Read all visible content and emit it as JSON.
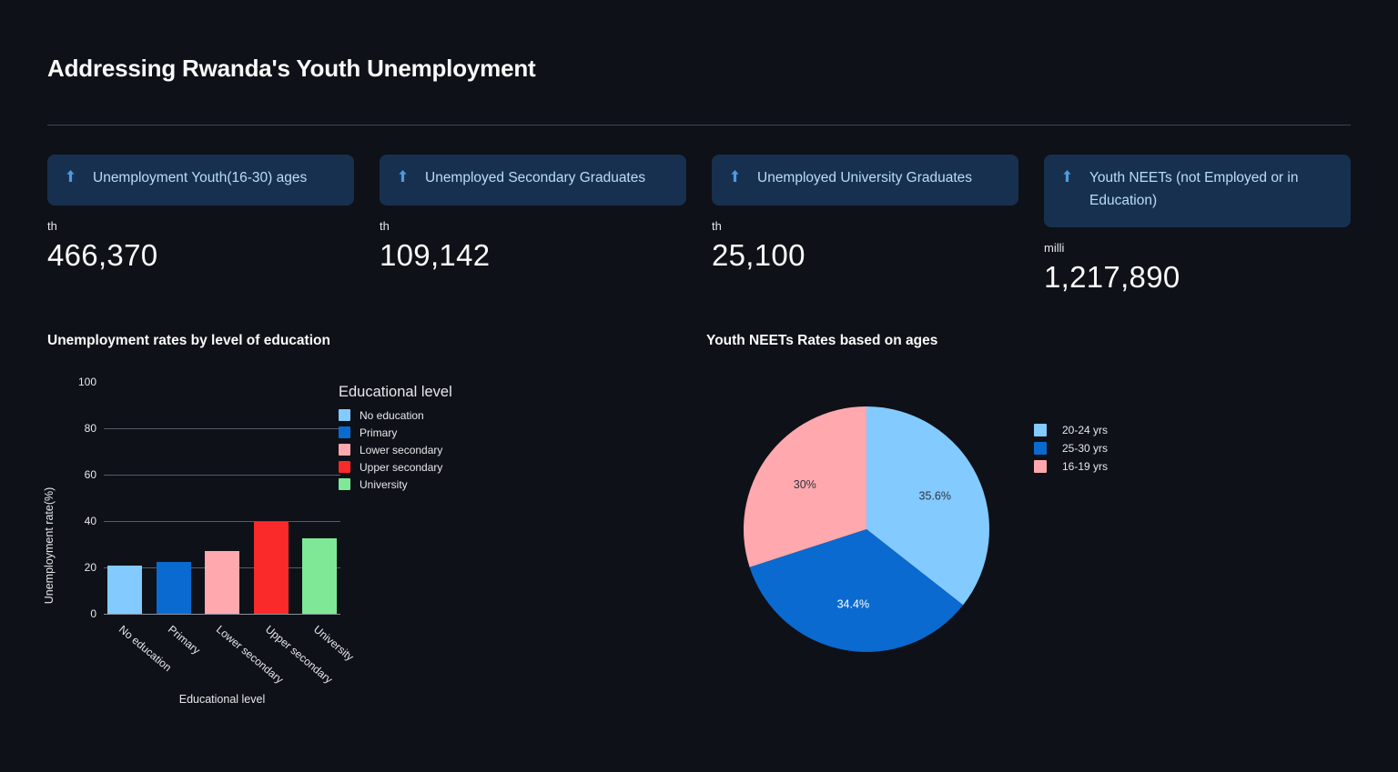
{
  "header": {
    "title": "Addressing Rwanda's Youth Unemployment"
  },
  "kpis": [
    {
      "icon": "trending-up-arrow-icon",
      "label": "Unemployment Youth(16-30) ages",
      "unit": "th",
      "value": "466,370"
    },
    {
      "icon": "trending-up-arrow-icon",
      "label": "Unemployed Secondary Graduates",
      "unit": "th",
      "value": "109,142"
    },
    {
      "icon": "trending-up-arrow-icon",
      "label": "Unemployed University Graduates",
      "unit": "th",
      "value": "25,100"
    },
    {
      "icon": "trending-up-arrow-icon",
      "label": "Youth NEETs (not Employed or in Education)",
      "unit": "milli",
      "value": "1,217,890"
    }
  ],
  "bar_section": {
    "heading": "Unemployment rates by level of education"
  },
  "pie_section": {
    "heading": "Youth NEETs Rates based on ages"
  },
  "colors": {
    "page_background": "#0E1117",
    "card_background": "#17304F",
    "card_label_text": "#B9DCFB",
    "accent_light_blue": "#82CAFF",
    "accent_blue": "#0A6AD0",
    "accent_pink": "#FFA8AE",
    "accent_red": "#FB2A2A",
    "accent_green": "#7EE897"
  },
  "chart_data": [
    {
      "type": "bar",
      "title": "Unemployment rates by level of education",
      "xlabel": "Educational level",
      "ylabel": "Unemployment rate(%)",
      "legend_title": "Educational level",
      "legend_position": "right",
      "grid": true,
      "ylim": [
        0,
        100
      ],
      "yticks": [
        0,
        20,
        40,
        60,
        80,
        100
      ],
      "categories": [
        "No education",
        "Primary",
        "Lower secondary",
        "Upper secondary",
        "University"
      ],
      "values": [
        20.7,
        22.4,
        27.1,
        39.5,
        32.7
      ],
      "colors": [
        "#82CAFF",
        "#0A6AD0",
        "#FFA8AE",
        "#FB2A2A",
        "#7EE897"
      ]
    },
    {
      "type": "pie",
      "title": "Youth NEETs Rates based on ages",
      "legend_position": "right",
      "labels": [
        "20-24 yrs",
        "25-30 yrs",
        "16-19 yrs"
      ],
      "values": [
        35.6,
        34.4,
        30.0
      ],
      "value_labels": [
        "35.6%",
        "34.4%",
        "30%"
      ],
      "colors": [
        "#82CAFF",
        "#0A6AD0",
        "#FFA8AE"
      ],
      "legend_order": [
        "20-24 yrs",
        "25-30 yrs",
        "16-19 yrs"
      ]
    }
  ]
}
